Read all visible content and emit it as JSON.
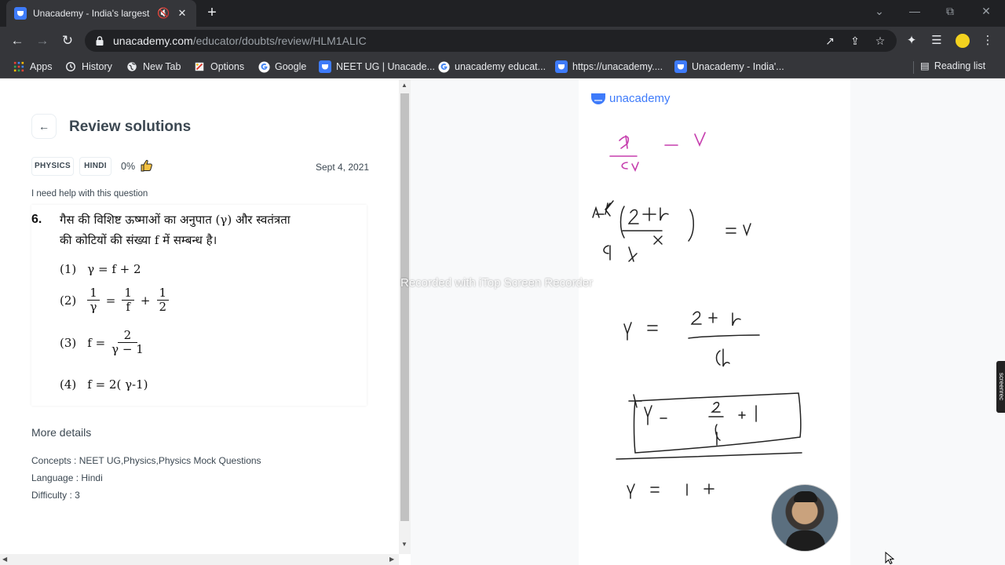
{
  "browser": {
    "tab_title": "Unacademy - India's largest l",
    "new_tab_symbol": "+",
    "url_host": "unacademy.com",
    "url_path": "/educator/doubts/review/HLM1ALIC",
    "bookmarks": [
      {
        "label": "Apps",
        "icon": "apps-grid-icon"
      },
      {
        "label": "History",
        "icon": "history-icon"
      },
      {
        "label": "New Tab",
        "icon": "globe-icon"
      },
      {
        "label": "Options",
        "icon": "options-icon"
      },
      {
        "label": "Google",
        "icon": "google-icon"
      },
      {
        "label": "NEET UG | Unacade...",
        "icon": "unacademy-icon"
      },
      {
        "label": "unacademy educat...",
        "icon": "google-icon"
      },
      {
        "label": "https://unacademy....",
        "icon": "unacademy-icon"
      },
      {
        "label": "Unacademy - India'...",
        "icon": "unacademy-icon"
      }
    ],
    "reading_list": "Reading list"
  },
  "page": {
    "title": "Review solutions",
    "tags": [
      "PHYSICS",
      "HINDI"
    ],
    "percent": "0%",
    "date": "Sept 4, 2021",
    "help_text": "I need help with this question",
    "question": {
      "number": "6.",
      "line1": "गैस की विशिष्ट ऊष्माओं का अनुपात (γ) और स्वतंत्रता",
      "line2": "की कोटियों की संख्या f में सम्बन्ध है।",
      "opt1_label": "(1)",
      "opt1_text": "γ = f + 2",
      "opt2_label": "(2)",
      "opt2_n1": "1",
      "opt2_d1": "γ",
      "opt2_eq": "=",
      "opt2_n2": "1",
      "opt2_d2": "f",
      "opt2_plus": "+",
      "opt2_n3": "1",
      "opt2_d3": "2",
      "opt3_label": "(3)",
      "opt3_lhs": "f =",
      "opt3_num": "2",
      "opt3_den": "γ − 1",
      "opt4_label": "(4)",
      "opt4_text": "f = 2( γ-1)"
    },
    "more_details": "More details",
    "concepts": "Concepts : NEET UG,Physics,Physics Mock Questions",
    "language": "Language : Hindi",
    "difficulty": "Difficulty : 3"
  },
  "board": {
    "brand": "unacademy",
    "watermark": "Recorded with iTop Screen Recorder",
    "side_tag": "screenrec",
    "colors": {
      "brand": "#3e7bfa",
      "pink": "#c63fae",
      "ink": "#222222"
    }
  }
}
